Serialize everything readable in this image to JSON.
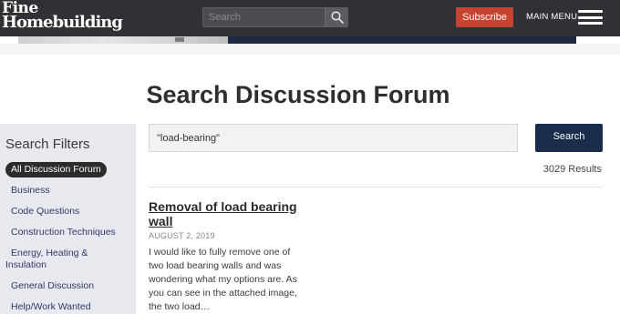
{
  "header": {
    "logo_line1": "Fine",
    "logo_line2": "Homebuilding",
    "search_placeholder": "Search",
    "subscribe_label": "Subscribe",
    "main_menu_label": "MAIN MENU"
  },
  "page": {
    "title": "Search Discussion Forum"
  },
  "sidebar": {
    "title": "Search Filters",
    "filters": [
      {
        "label": "All Discussion Forum",
        "active": true
      },
      {
        "label": "Business",
        "active": false
      },
      {
        "label": "Code Questions",
        "active": false
      },
      {
        "label": "Construction Techniques",
        "active": false
      },
      {
        "label": "Energy, Heating & Insulation",
        "active": false
      },
      {
        "label": "General Discussion",
        "active": false
      },
      {
        "label": "Help/Work Wanted",
        "active": false
      }
    ]
  },
  "search": {
    "query": "\"load-bearing\"",
    "button_label": "Search",
    "results_count": "3029 Results"
  },
  "results": [
    {
      "title": "Removal of load bearing wall",
      "date": "AUGUST 2, 2019",
      "excerpt": "I would like to fully remove one of two load bearing walls and was wondering what my options are. As you can see in the attached image, the two load…"
    }
  ],
  "colors": {
    "topbar": "#2f3134",
    "subscribe": "#c8432f",
    "search_button": "#1a2e4c",
    "sidebar": "#e8e9ee",
    "filter_link": "#2d3a66"
  }
}
